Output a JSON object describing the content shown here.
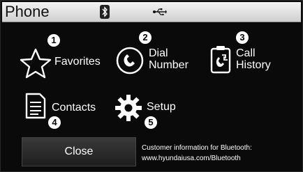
{
  "header": {
    "title": "Phone",
    "icons": [
      "bluetooth-icon",
      "usb-icon"
    ]
  },
  "menu": {
    "favorites": {
      "label": "Favorites",
      "badge": "1",
      "icon": "star-icon"
    },
    "dial_number": {
      "label": "Dial\nNumber",
      "badge": "2",
      "icon": "handset-icon"
    },
    "call_history": {
      "label": "Call\nHistory",
      "badge": "3",
      "icon": "call-history-icon"
    },
    "contacts": {
      "label": "Contacts",
      "badge": "4",
      "icon": "contacts-icon"
    },
    "setup": {
      "label": "Setup",
      "badge": "5",
      "icon": "gear-icon"
    }
  },
  "footer": {
    "close_label": "Close",
    "info_line1": "Customer information for Bluetooth:",
    "info_line2": "www.hyundaiusa.com/Bluetooth"
  }
}
